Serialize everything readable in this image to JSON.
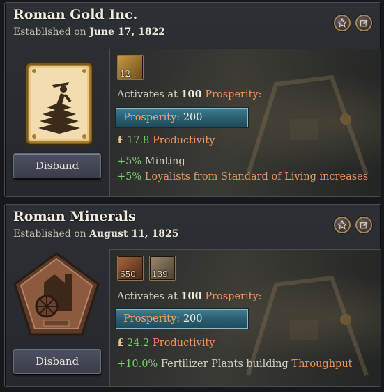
{
  "companies": [
    {
      "name": "Roman Gold Inc.",
      "established_label": "Established on",
      "established_date": "June 17, 1822",
      "badges": [
        {
          "icon": "gold-resource-icon",
          "count": "12"
        }
      ],
      "activates_prefix": "Activates at",
      "activates_value": "100",
      "activates_suffix": "Prosperity:",
      "prosperity_label": "Prosperity:",
      "prosperity_value": "200",
      "productivity_value": "17.8",
      "productivity_label": "Productivity",
      "effects": [
        {
          "value": "+5%",
          "parts": [
            "Minting"
          ]
        },
        {
          "value": "+5%",
          "parts": [
            "Loyalists from",
            "Standard of Living",
            "increases"
          ]
        }
      ],
      "disband_label": "Disband"
    },
    {
      "name": "Roman Minerals",
      "established_label": "Established on",
      "established_date": "August 11, 1825",
      "badges": [
        {
          "icon": "sulfur-resource-icon",
          "count": "650"
        },
        {
          "icon": "iron-resource-icon",
          "count": "139"
        }
      ],
      "activates_prefix": "Activates at",
      "activates_value": "100",
      "activates_suffix": "Prosperity:",
      "prosperity_label": "Prosperity:",
      "prosperity_value": "200",
      "productivity_value": "24.2",
      "productivity_label": "Productivity",
      "effects": [
        {
          "value": "+10.0%",
          "parts": [
            "Fertilizer Plants building",
            "Throughput"
          ]
        }
      ],
      "disband_label": "Disband"
    }
  ],
  "currency_symbol": "£",
  "colors": {
    "accent_orange": "#f0955d",
    "positive_green": "#7fce6e",
    "prosperity_bar": "#2b5f71"
  }
}
